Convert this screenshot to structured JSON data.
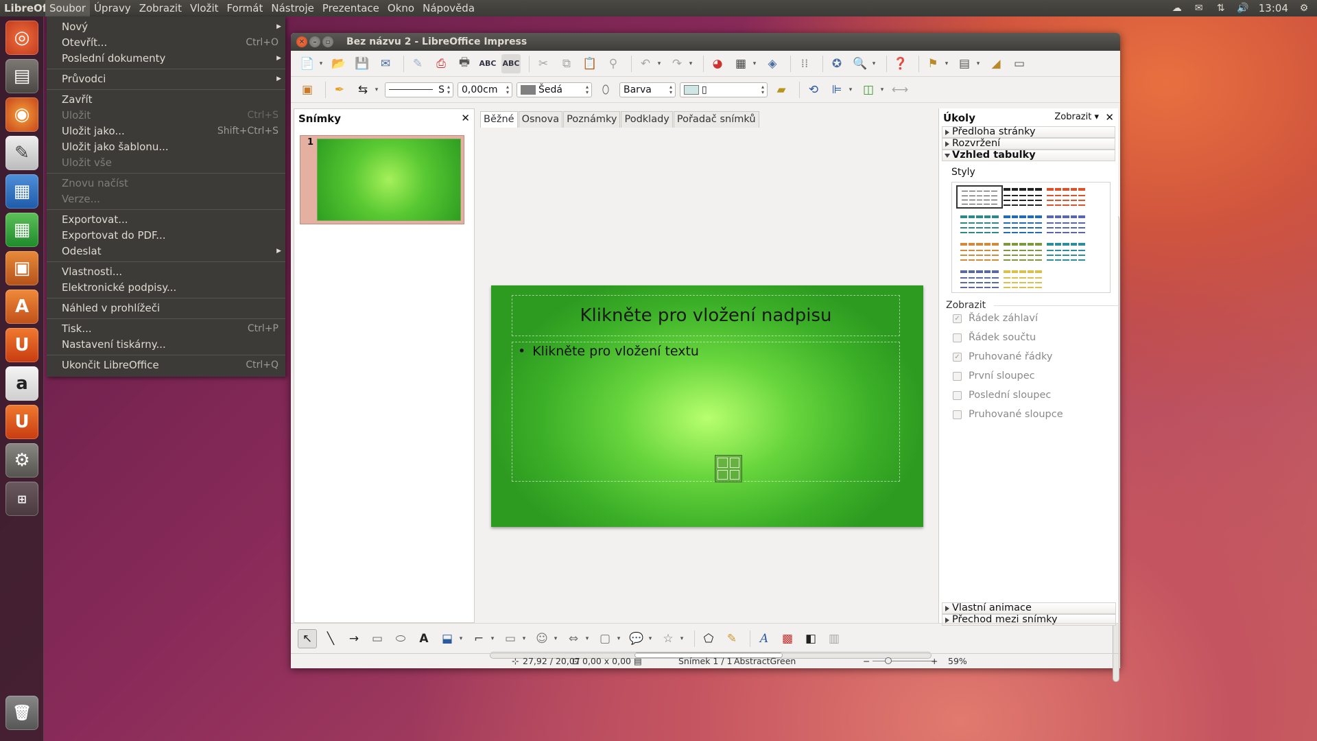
{
  "topbar": {
    "app_name": "LibreOffice Impress",
    "menus": [
      "Soubor",
      "Úpravy",
      "Zobrazit",
      "Vložit",
      "Formát",
      "Nástroje",
      "Prezentace",
      "Okno",
      "Nápověda"
    ],
    "clock": "13:04"
  },
  "file_menu": {
    "items": [
      {
        "label": "Nový",
        "shortcut": "",
        "submenu": true,
        "disabled": false
      },
      {
        "label": "Otevřít...",
        "shortcut": "Ctrl+O",
        "submenu": false,
        "disabled": false
      },
      {
        "label": "Poslední dokumenty",
        "shortcut": "",
        "submenu": true,
        "disabled": false
      },
      {
        "sep": true
      },
      {
        "label": "Průvodci",
        "shortcut": "",
        "submenu": true,
        "disabled": false
      },
      {
        "sep": true
      },
      {
        "label": "Zavřít",
        "shortcut": "",
        "submenu": false,
        "disabled": false
      },
      {
        "label": "Uložit",
        "shortcut": "Ctrl+S",
        "submenu": false,
        "disabled": true
      },
      {
        "label": "Uložit jako...",
        "shortcut": "Shift+Ctrl+S",
        "submenu": false,
        "disabled": false
      },
      {
        "label": "Uložit jako šablonu...",
        "shortcut": "",
        "submenu": false,
        "disabled": false
      },
      {
        "label": "Uložit vše",
        "shortcut": "",
        "submenu": false,
        "disabled": true
      },
      {
        "sep": true
      },
      {
        "label": "Znovu načíst",
        "shortcut": "",
        "submenu": false,
        "disabled": true
      },
      {
        "label": "Verze...",
        "shortcut": "",
        "submenu": false,
        "disabled": true
      },
      {
        "sep": true
      },
      {
        "label": "Exportovat...",
        "shortcut": "",
        "submenu": false,
        "disabled": false
      },
      {
        "label": "Exportovat do PDF...",
        "shortcut": "",
        "submenu": false,
        "disabled": false
      },
      {
        "label": "Odeslat",
        "shortcut": "",
        "submenu": true,
        "disabled": false
      },
      {
        "sep": true
      },
      {
        "label": "Vlastnosti...",
        "shortcut": "",
        "submenu": false,
        "disabled": false
      },
      {
        "label": "Elektronické podpisy...",
        "shortcut": "",
        "submenu": false,
        "disabled": false
      },
      {
        "sep": true
      },
      {
        "label": "Náhled v prohlížeči",
        "shortcut": "",
        "submenu": false,
        "disabled": false
      },
      {
        "sep": true
      },
      {
        "label": "Tisk...",
        "shortcut": "Ctrl+P",
        "submenu": false,
        "disabled": false
      },
      {
        "label": "Nastavení tiskárny...",
        "shortcut": "",
        "submenu": false,
        "disabled": false
      },
      {
        "sep": true
      },
      {
        "label": "Ukončit LibreOffice",
        "shortcut": "Ctrl+Q",
        "submenu": false,
        "disabled": false
      }
    ]
  },
  "window": {
    "title": "Bez názvu 2 - LibreOffice Impress",
    "line_style_value": "S",
    "line_width_value": "0,00cm",
    "line_color_value": "Šedá",
    "fill_type_value": "Barva",
    "fill_color_value": "▯"
  },
  "slides_pane": {
    "title": "Snímky",
    "slide_number": "1"
  },
  "view_tabs": [
    "Běžné",
    "Osnova",
    "Poznámky",
    "Podklady",
    "Pořadač snímků"
  ],
  "slide": {
    "title_placeholder": "Klikněte pro vložení nadpisu",
    "body_placeholder": "Klikněte pro vložení textu",
    "bullet": "•"
  },
  "task_pane": {
    "title": "Úkoly",
    "view_label": "Zobrazit",
    "sections_top": [
      "Předloha stránky",
      "Rozvržení",
      "Vzhled tabulky"
    ],
    "styles_label": "Styly",
    "show_label": "Zobrazit",
    "options": [
      {
        "label": "Řádek záhlaví",
        "checked": true
      },
      {
        "label": "Řádek součtu",
        "checked": false
      },
      {
        "label": "Pruhované řádky",
        "checked": true
      },
      {
        "label": "První sloupec",
        "checked": false
      },
      {
        "label": "Poslední sloupec",
        "checked": false
      },
      {
        "label": "Pruhované sloupce",
        "checked": false
      }
    ],
    "sections_bottom": [
      "Vlastní animace",
      "Přechod mezi snímky"
    ],
    "table_style_colors": [
      "#ffffff",
      "#222222",
      "#d9542b",
      "#2a8a8a",
      "#1e6bb8",
      "#5865b0",
      "#d58a3a",
      "#7d9a3a",
      "#2a8f9a",
      "#5a6aa0",
      "#d8c04a"
    ]
  },
  "statusbar": {
    "position": "27,92 / 20,07",
    "size": "0,00 x 0,00",
    "slide_info": "Snímek 1 / 1",
    "master": "AbstractGreen",
    "zoom": "59%"
  }
}
